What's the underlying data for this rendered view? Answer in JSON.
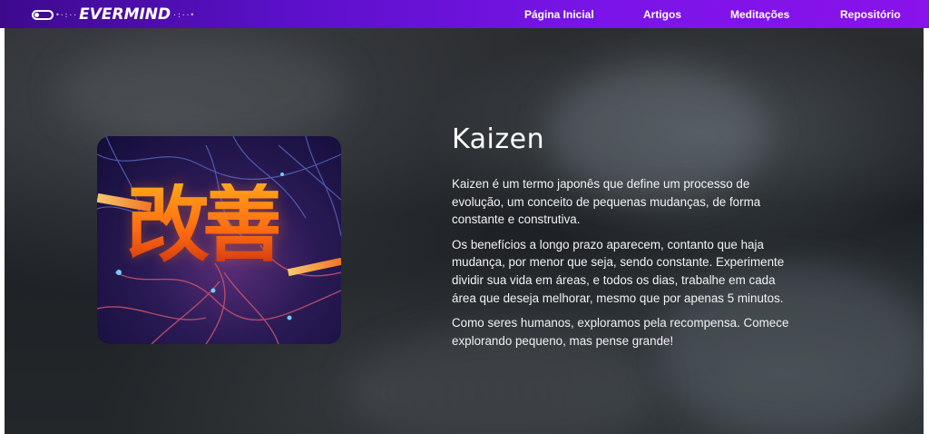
{
  "brand": {
    "name": "EVERMIND",
    "dots": "•·:··",
    "trail": "·:··•"
  },
  "nav": {
    "items": [
      {
        "label": "Página Inicial"
      },
      {
        "label": "Artigos"
      },
      {
        "label": "Meditações"
      },
      {
        "label": "Repositório"
      }
    ]
  },
  "hero": {
    "title": "Kaizen",
    "image_text": "改善",
    "paragraphs": [
      "Kaizen é um termo japonês que define um processo de evolução, um conceito de pequenas mudanças, de forma constante e construtiva.",
      "Os benefícios a longo prazo aparecem, contanto que haja mudança, por menor que seja, sendo constante. Experimente dividir sua vida em áreas, e todos os dias, trabalhe em cada área que deseja melhorar, mesmo que por apenas 5 minutos.",
      "Como seres humanos, exploramos pela recompensa. Comece explorando pequeno, mas pense grande!"
    ]
  },
  "colors": {
    "nav_start": "#3d0a8c",
    "nav_end": "#8a12ea",
    "hero_bg": "#1d2125",
    "glyph_orange": "#ff8a10"
  }
}
